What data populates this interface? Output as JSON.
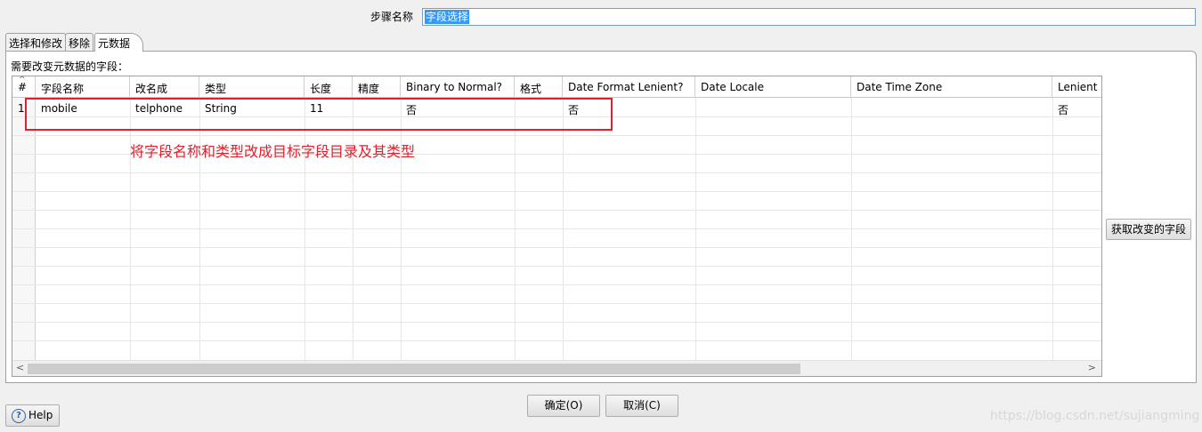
{
  "step": {
    "label": "步骤名称",
    "value": "字段选择"
  },
  "tabs": [
    {
      "label": "选择和修改"
    },
    {
      "label": "移除"
    },
    {
      "label": "元数据"
    }
  ],
  "panel": {
    "label": "需要改变元数据的字段："
  },
  "table": {
    "headers": [
      "#",
      "字段名称",
      "改名成",
      "类型",
      "长度",
      "精度",
      "Binary to Normal?",
      "格式",
      "Date Format Lenient?",
      "Date Locale",
      "Date Time Zone",
      "Lenient r"
    ],
    "rows": [
      {
        "num": "1",
        "field": "mobile",
        "rename": "telphone",
        "type": "String",
        "length": "11",
        "precision": "",
        "binary": "否",
        "format": "",
        "lenient": "否",
        "locale": "",
        "timezone": "",
        "lenient2": "否"
      }
    ]
  },
  "annotation": {
    "text": "将字段名称和类型改成目标字段目录及其类型",
    "color": "#e0202c"
  },
  "buttons": {
    "get_fields": "获取改变的字段",
    "ok": "确定(O)",
    "cancel": "取消(C)",
    "help": "Help"
  },
  "watermark": "https://blog.csdn.net/sujiangming"
}
